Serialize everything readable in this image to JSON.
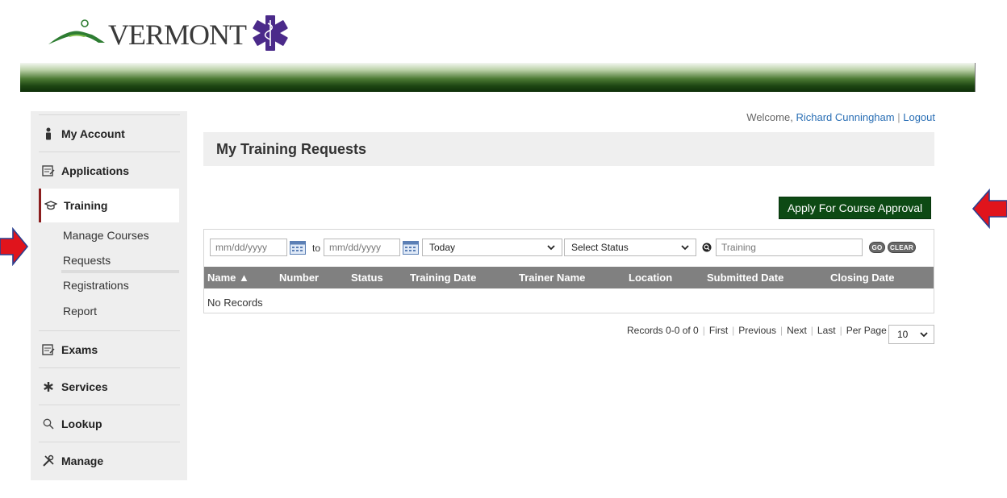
{
  "logo": {
    "text": "VERMONT"
  },
  "user": {
    "welcome": "Welcome,",
    "name": "Richard Cunningham",
    "logout": "Logout"
  },
  "sidebar": {
    "items": [
      {
        "label": "My Account",
        "icon": "user-icon"
      },
      {
        "label": "Applications",
        "icon": "clipboard-icon"
      },
      {
        "label": "Training",
        "icon": "graduation-cap-icon"
      },
      {
        "label": "Exams",
        "icon": "clipboard-icon"
      },
      {
        "label": "Services",
        "icon": "asterisk-icon"
      },
      {
        "label": "Lookup",
        "icon": "search-icon"
      },
      {
        "label": "Manage",
        "icon": "tools-icon"
      }
    ],
    "training_sub": [
      "Manage Courses",
      "Requests",
      "Registrations",
      "Report"
    ]
  },
  "page": {
    "title": "My Training Requests",
    "apply_button": "Apply For Course Approval"
  },
  "filters": {
    "date_from_placeholder": "mm/dd/yyyy",
    "to_label": "to",
    "date_to_placeholder": "mm/dd/yyyy",
    "date_range": "Today",
    "status": "Select Status",
    "search_placeholder": "Training",
    "go_label": "GO",
    "clear_label": "CLEAR"
  },
  "table": {
    "columns": [
      "Name ▲",
      "Number",
      "Status",
      "Training Date",
      "Trainer Name",
      "Location",
      "Submitted Date",
      "Closing Date"
    ],
    "empty_text": "No Records"
  },
  "pager": {
    "records": "Records 0-0 of 0",
    "first": "First",
    "previous": "Previous",
    "next": "Next",
    "last": "Last",
    "per_page_label": "Per Page",
    "per_page_value": "10"
  },
  "colors": {
    "brand_green": "#0d4a14",
    "active_marker": "#8b1d1d",
    "arrow_red": "#e0141c",
    "link_blue": "#2a6fb5"
  }
}
